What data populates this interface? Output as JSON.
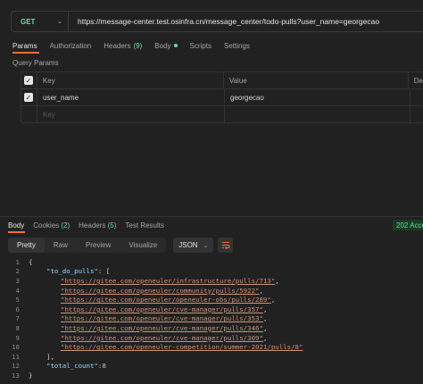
{
  "request": {
    "method": "GET",
    "url": "https://message-center.test.osinfra.cn/message_center/todo-pulls?user_name=georgecao"
  },
  "request_tabs": [
    {
      "label": "Params",
      "active": true
    },
    {
      "label": "Authorization"
    },
    {
      "label": "Headers",
      "count": "(9)"
    },
    {
      "label": "Body",
      "dot": true
    },
    {
      "label": "Scripts"
    },
    {
      "label": "Settings"
    }
  ],
  "query_params": {
    "title": "Query Params",
    "headers": {
      "key": "Key",
      "value": "Value",
      "desc": "De"
    },
    "rows": [
      {
        "key": "user_name",
        "value": "georgecao"
      }
    ],
    "placeholder_key": "Key"
  },
  "response_tabs": [
    {
      "label": "Body",
      "active": true
    },
    {
      "label": "Cookies",
      "count": "(2)"
    },
    {
      "label": "Headers",
      "count": "(5)"
    },
    {
      "label": "Test Results"
    }
  ],
  "status_text": "202 Acce",
  "view": {
    "modes": [
      "Pretty",
      "Raw",
      "Preview",
      "Visualize"
    ],
    "active_mode": "Pretty",
    "format": "JSON"
  },
  "code": {
    "open_brace": "{",
    "key_list": "\"to_do_pulls\"",
    "list_open": ": [",
    "urls": [
      "\"https://gitee.com/openeuler/infrastructure/pulls/713\"",
      "\"https://gitee.com/openeuler/community/pulls/5922\"",
      "\"https://gitee.com/openeuler/openeuler-obs/pulls/289\"",
      "\"https://gitee.com/openeuler/cve-manager/pulls/357\"",
      "\"https://gitee.com/openeuler/cve-manager/pulls/353\"",
      "\"https://gitee.com/openeuler/cve-manager/pulls/346\"",
      "\"https://gitee.com/openeuler/cve-manager/pulls/309\"",
      "\"https://gitee.com/openeuler-competition/summer-2021/pulls/8\""
    ],
    "list_close": "],",
    "key_total": "\"total_count\"",
    "total_value": "8",
    "close_brace": "}",
    "line_numbers": [
      "1",
      "2",
      "3",
      "4",
      "5",
      "6",
      "7",
      "8",
      "9",
      "10",
      "11",
      "12",
      "13"
    ]
  },
  "colors": {
    "accent": "#ff6c37",
    "method": "#6bdd9a",
    "background": "#212121"
  }
}
